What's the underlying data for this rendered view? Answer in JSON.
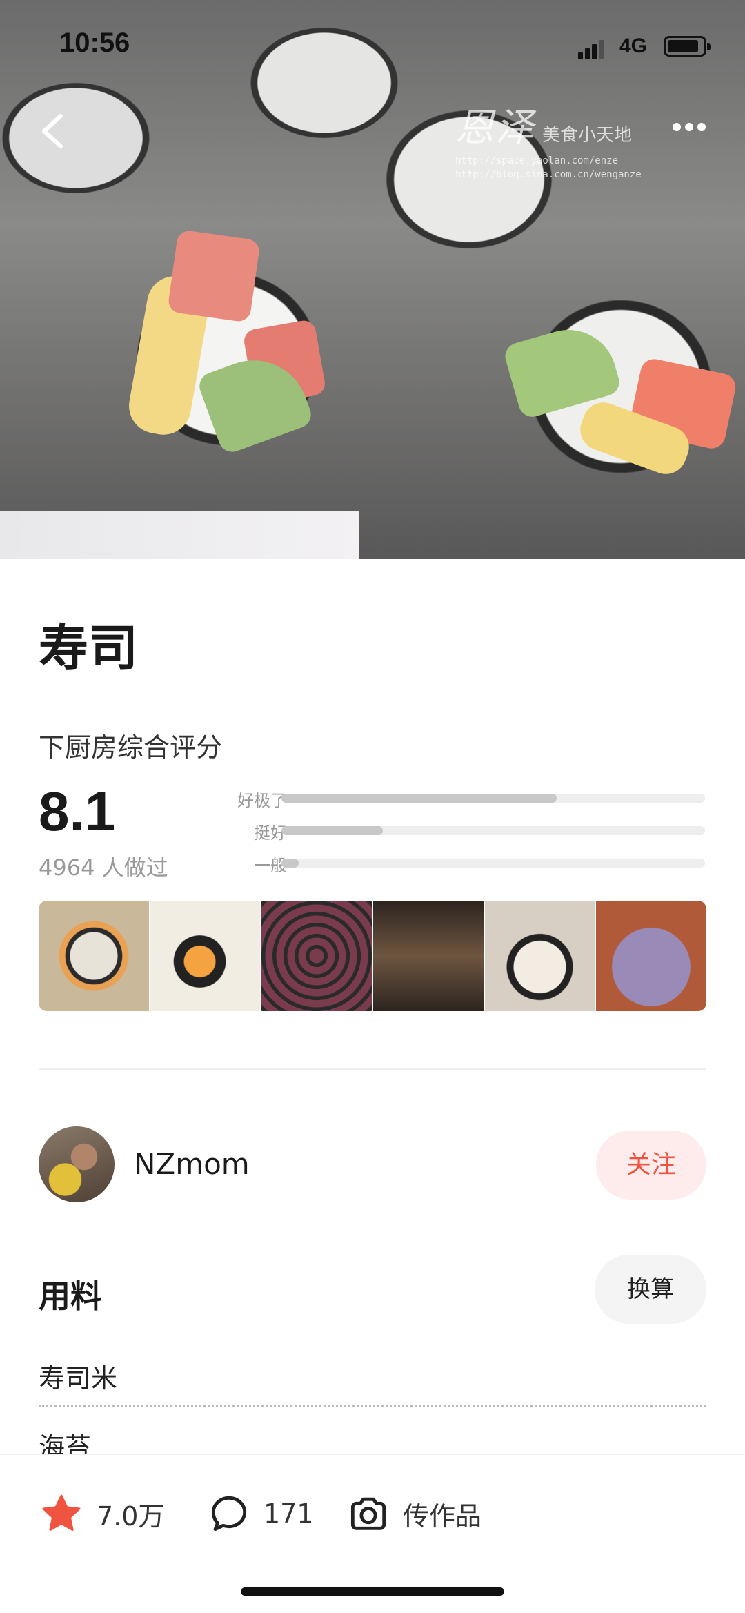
{
  "status_bar": {
    "time": "10:56",
    "network": "4G"
  },
  "hero": {
    "watermark_title": "恩泽",
    "watermark_subtitle": "美食小天地",
    "watermark_url_1": "http://space.yaolan.com/enze",
    "watermark_url_2": "http://blog.sina.com.cn/wenganze"
  },
  "recipe": {
    "title": "寿司",
    "score_label": "下厨房综合评分",
    "score": "8.1",
    "made_count": "4964 人做过",
    "ratings": [
      {
        "label": "好极了",
        "fraction": 0.65
      },
      {
        "label": "挺好",
        "fraction": 0.24
      },
      {
        "label": "一般",
        "fraction": 0.04
      }
    ]
  },
  "author": {
    "name": "NZmom",
    "follow_label": "关注"
  },
  "ingredients": {
    "title": "用料",
    "convert_label": "换算",
    "items": [
      "寿司米",
      "海苔"
    ]
  },
  "bottom_bar": {
    "favorites": "7.0万",
    "comments": "171",
    "upload_label": "传作品"
  },
  "colors": {
    "accent": "#f05440",
    "star": "#f05440"
  }
}
